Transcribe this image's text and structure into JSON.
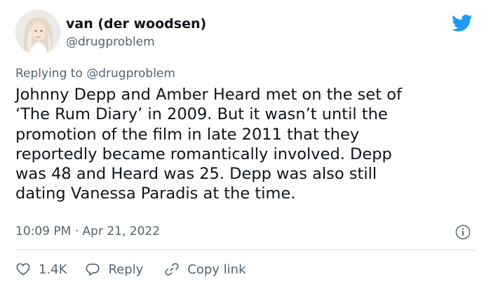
{
  "author": {
    "display_name": "van (der woodsen)",
    "handle": "@drugproblem"
  },
  "replying": {
    "prefix": "Replying to",
    "handle": "@drugproblem"
  },
  "tweet": {
    "lines": [
      "Johnny Depp and Amber Heard met on the set of",
      "‘The Rum Diary’ in 2009. But it wasn’t until the",
      "promotion of the film in late 2011 that they",
      "reportedly became romantically involved. Depp",
      "was 48 and Heard was 25. Depp was also still",
      "dating Vanessa Paradis at the time."
    ],
    "timestamp": "10:09 PM · Apr 21, 2022"
  },
  "actions": {
    "likes": "1.4K",
    "reply_label": "Reply",
    "copy_link_label": "Copy link"
  },
  "icons": {
    "brand": "twitter-bird-icon",
    "info": "info-icon",
    "like": "heart-icon",
    "reply": "speech-bubble-icon",
    "copy": "link-icon"
  },
  "colors": {
    "brand_blue": "#1d9bf0",
    "text_primary": "#0f1419",
    "text_secondary": "#536471",
    "divider": "#cfd9de"
  }
}
